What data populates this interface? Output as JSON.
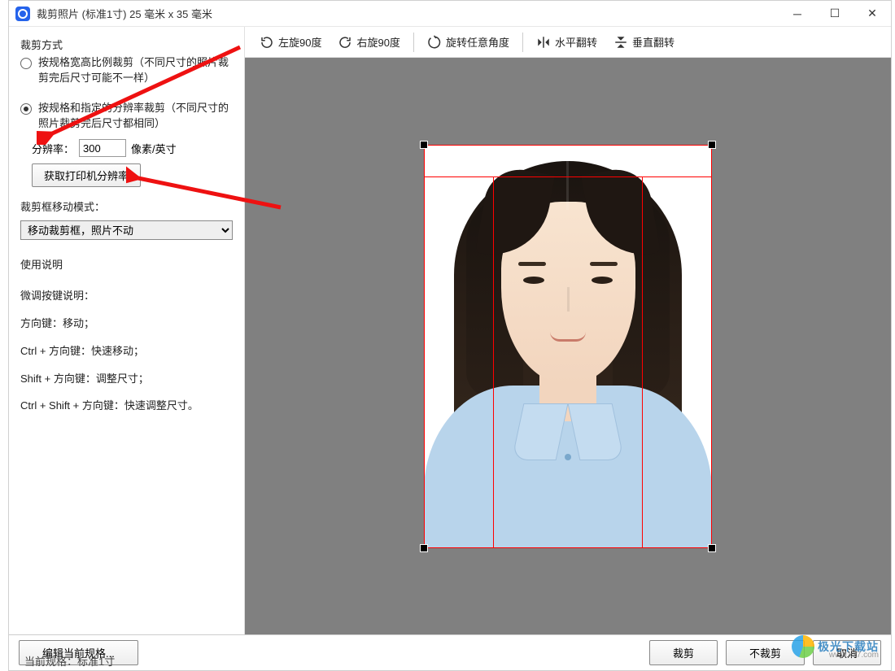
{
  "title": "裁剪照片 (标准1寸) 25 毫米 x 35 毫米",
  "sidebar": {
    "crop_method_label": "裁剪方式",
    "radio1": "按规格宽高比例裁剪（不同尺寸的照片裁剪完后尺寸可能不一样）",
    "radio2": "按规格和指定的分辨率裁剪（不同尺寸的照片裁剪完后尺寸都相同）",
    "resolution_label": "分辨率：",
    "resolution_value": "300",
    "resolution_unit": "像素/英寸",
    "printer_btn": "获取打印机分辨率",
    "move_mode_label": "裁剪框移动模式：",
    "move_mode_value": "移动裁剪框，照片不动",
    "instructions_title": "使用说明",
    "instr1": "微调按键说明：",
    "instr2": "方向键：移动；",
    "instr3": "Ctrl + 方向键：快速移动；",
    "instr4": "Shift + 方向键：调整尺寸；",
    "instr5": "Ctrl + Shift + 方向键：快速调整尺寸。"
  },
  "toolbar": {
    "rotate_left": "左旋90度",
    "rotate_right": "右旋90度",
    "rotate_any": "旋转任意角度",
    "flip_h": "水平翻转",
    "flip_v": "垂直翻转"
  },
  "bottom": {
    "edit_spec": "编辑当前规格...",
    "crop": "裁剪",
    "no_crop": "不裁剪",
    "cancel": "取消"
  },
  "status": "当前规格：标准1寸",
  "watermark": {
    "text": "极光下载站",
    "url": "www.xz7.com"
  }
}
